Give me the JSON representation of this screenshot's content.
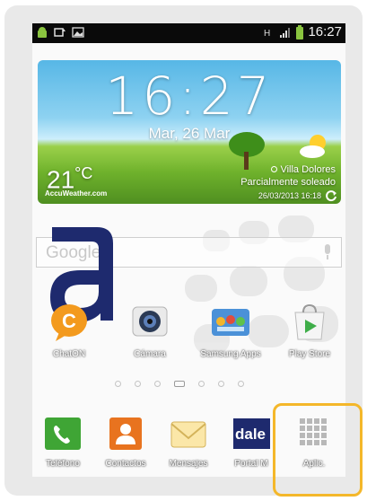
{
  "statusbar": {
    "time": "16:27",
    "icons": [
      "android-icon",
      "sync-icon",
      "gallery-icon",
      "hplus-icon",
      "signal-icon",
      "battery-icon"
    ]
  },
  "weather_widget": {
    "time": "16:27",
    "date": "Mar, 26 Mar",
    "temperature": "21",
    "unit": "°C",
    "provider": "AccuWeather.com",
    "location": "Villa Dolores",
    "condition": "Parcialmente soleado",
    "updated": "26/03/2013 16:18"
  },
  "search": {
    "brand": "Google"
  },
  "apps": [
    {
      "label": "ChatON",
      "icon": "chaton-icon"
    },
    {
      "label": "Cámara",
      "icon": "camera-icon"
    },
    {
      "label": "Samsung Apps",
      "icon": "samsung-apps-icon"
    },
    {
      "label": "Play Store",
      "icon": "play-store-icon"
    }
  ],
  "page_indicator": {
    "pages": 7,
    "current": 4
  },
  "dock": [
    {
      "label": "Teléfono",
      "icon": "phone-icon"
    },
    {
      "label": "Contactos",
      "icon": "contacts-icon"
    },
    {
      "label": "Mensajes",
      "icon": "messages-icon"
    },
    {
      "label": "Portal M",
      "icon": "dale-icon",
      "brand": "dale"
    },
    {
      "label": "Aplic.",
      "icon": "apps-grid-icon"
    }
  ],
  "colors": {
    "highlight": "#f4b72a",
    "logo_navy": "#1e2a6e",
    "chaton_orange": "#f39a1e",
    "phone_green": "#3fa535",
    "contacts_orange": "#e8731f"
  }
}
